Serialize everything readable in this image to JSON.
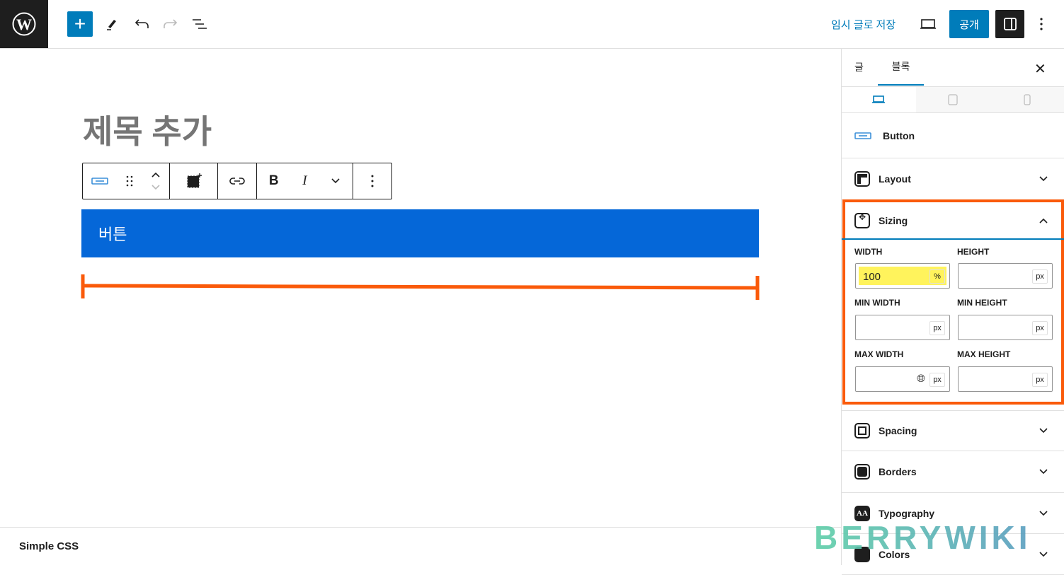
{
  "header": {
    "save_draft": "임시 글로 저장",
    "publish": "공개"
  },
  "editor": {
    "title_placeholder": "제목 추가",
    "button_text": "버튼",
    "footer": "Simple CSS"
  },
  "sidebar": {
    "tabs": [
      {
        "label": "글"
      },
      {
        "label": "블록",
        "active": true
      }
    ],
    "block_name": "Button",
    "sections": {
      "layout": "Layout",
      "sizing": "Sizing",
      "spacing": "Spacing",
      "borders": "Borders",
      "typography": "Typography",
      "colors": "Colors"
    },
    "sizing": {
      "width_label": "WIDTH",
      "width_value": "100",
      "width_unit": "%",
      "height_label": "HEIGHT",
      "height_unit": "px",
      "min_width_label": "MIN WIDTH",
      "min_width_unit": "px",
      "min_height_label": "MIN HEIGHT",
      "min_height_unit": "px",
      "max_width_label": "MAX WIDTH",
      "max_width_unit": "px",
      "max_height_label": "MAX HEIGHT",
      "max_height_unit": "px"
    }
  },
  "watermark": "BERRYWIKI",
  "colors": {
    "accent": "#007cba",
    "button_block": "#0567d8",
    "highlight": "#fff35c",
    "annotation": "#fa5a0a"
  }
}
